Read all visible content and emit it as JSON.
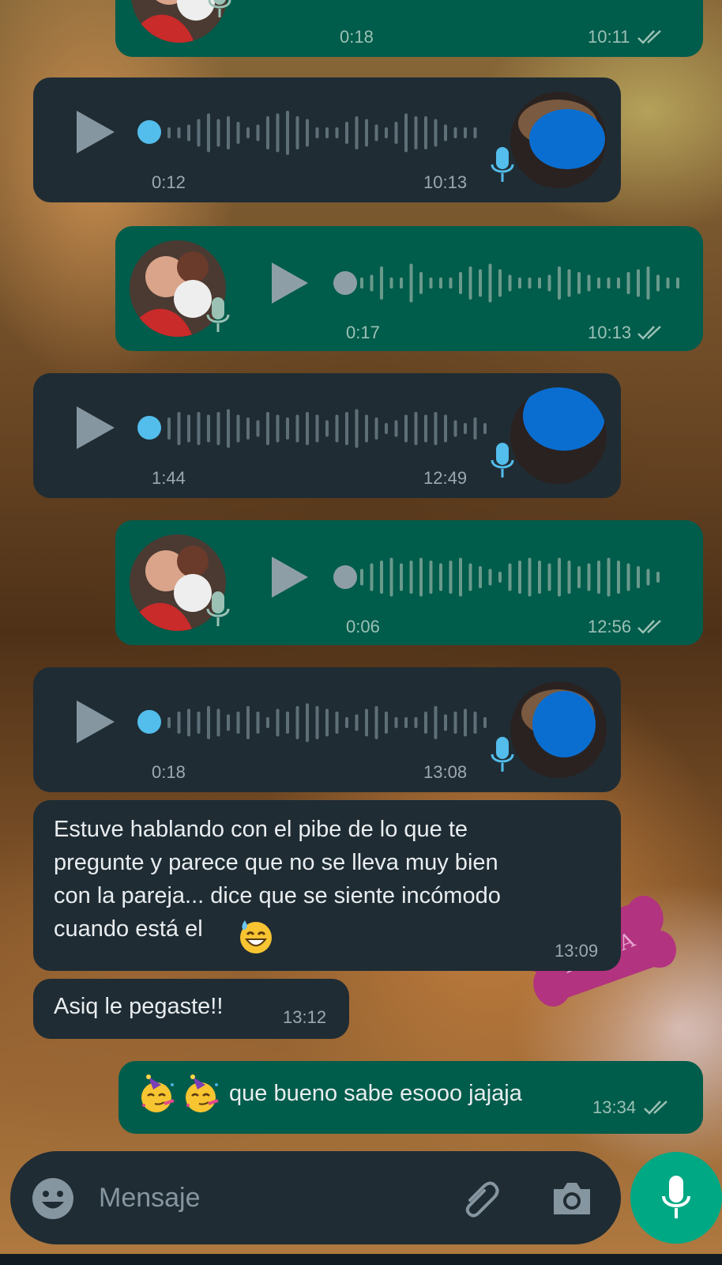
{
  "chat": {
    "messages": [
      {
        "type": "voice",
        "direction": "outgoing",
        "duration": "0:18",
        "time": "10:11",
        "status": "read"
      },
      {
        "type": "voice",
        "direction": "incoming",
        "duration": "0:12",
        "time": "10:13"
      },
      {
        "type": "voice",
        "direction": "outgoing",
        "duration": "0:17",
        "time": "10:13",
        "status": "read"
      },
      {
        "type": "voice",
        "direction": "incoming",
        "duration": "1:44",
        "time": "12:49"
      },
      {
        "type": "voice",
        "direction": "outgoing",
        "duration": "0:06",
        "time": "12:56",
        "status": "read"
      },
      {
        "type": "voice",
        "direction": "incoming",
        "duration": "0:18",
        "time": "13:08"
      },
      {
        "type": "text",
        "direction": "incoming",
        "lines": [
          "Estuve hablando con el pibe de lo que te",
          "pregunte y parece que no se lleva muy bien",
          "con la pareja... dice que se siente incómodo",
          "cuando está el"
        ],
        "emoji": "grinning-sweat-emoji",
        "time": "13:09"
      },
      {
        "type": "text",
        "direction": "incoming",
        "text": "Asiq le pegaste!!",
        "time": "13:12"
      },
      {
        "type": "text",
        "direction": "outgoing",
        "text": "que bueno sabe esooo jajaja",
        "emoji": [
          "partying-face-emoji",
          "partying-face-emoji"
        ],
        "time": "13:34",
        "status": "read"
      }
    ]
  },
  "input": {
    "placeholder": "Mensaje",
    "icons": {
      "emoji": "emoji-icon",
      "attach": "paperclip-icon",
      "camera": "camera-icon",
      "send": "mic-icon"
    }
  },
  "wallpaper": {
    "tag_text": "XUXA"
  },
  "colors": {
    "incoming_bubble": "#1f2c34",
    "outgoing_bubble": "#005c4b",
    "accent": "#00a884",
    "played_dot": "#53bdeb",
    "read_ticks": "#9bc1b5",
    "censor_blob": "#0a6ed1"
  }
}
